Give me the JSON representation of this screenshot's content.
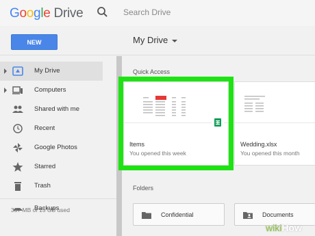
{
  "brand": {
    "google": [
      "G",
      "o",
      "o",
      "g",
      "l",
      "e"
    ],
    "product": "Drive"
  },
  "search": {
    "placeholder": "Search Drive"
  },
  "toolbar": {
    "new_label": "NEW",
    "location_title": "My Drive"
  },
  "sidebar": {
    "items": [
      {
        "label": "My Drive",
        "icon": "drive-icon",
        "active": true,
        "expandable": true
      },
      {
        "label": "Computers",
        "icon": "computer-icon",
        "expandable": true
      },
      {
        "label": "Shared with me",
        "icon": "people-icon"
      },
      {
        "label": "Recent",
        "icon": "clock-icon"
      },
      {
        "label": "Google Photos",
        "icon": "pinwheel-icon"
      },
      {
        "label": "Starred",
        "icon": "star-icon"
      },
      {
        "label": "Trash",
        "icon": "trash-icon"
      },
      {
        "label": "Backups",
        "icon": "cloud-icon"
      }
    ],
    "storage": "337 MB of 15 GB used"
  },
  "main": {
    "quick_access_label": "Quick Access",
    "quick_access": [
      {
        "name": "Items",
        "subtitle": "You opened this week",
        "icon": "sheets-icon",
        "highlighted": true
      },
      {
        "name": "Wedding.xlsx",
        "subtitle": "You opened this month"
      }
    ],
    "folders_label": "Folders",
    "folders": [
      {
        "name": "Confidential",
        "icon": "folder-icon"
      },
      {
        "name": "Documents",
        "icon": "shared-folder-icon"
      }
    ]
  },
  "watermark": {
    "wiki": "wiki",
    "how": "How"
  },
  "colors": {
    "accent": "#4a86e8",
    "highlight": "#1ee313",
    "sheets": "#0f9d58"
  }
}
